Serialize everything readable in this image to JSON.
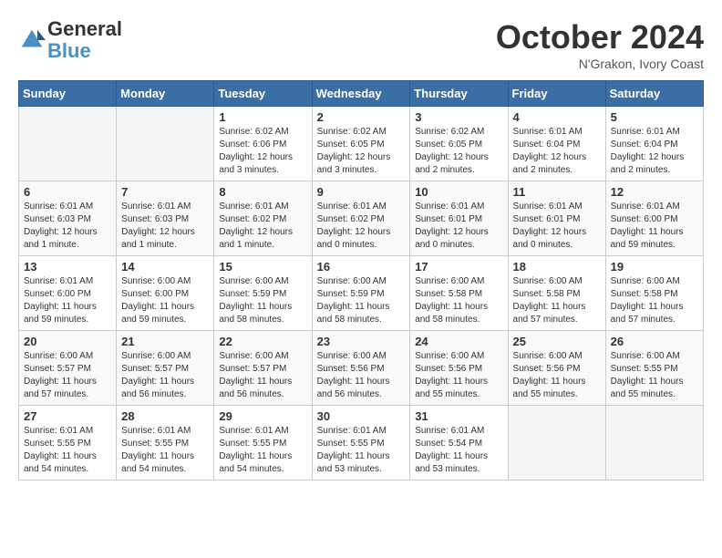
{
  "logo": {
    "text_general": "General",
    "text_blue": "Blue"
  },
  "header": {
    "month_title": "October 2024",
    "location": "N'Grakon, Ivory Coast"
  },
  "weekdays": [
    "Sunday",
    "Monday",
    "Tuesday",
    "Wednesday",
    "Thursday",
    "Friday",
    "Saturday"
  ],
  "weeks": [
    [
      {
        "day": "",
        "info": ""
      },
      {
        "day": "",
        "info": ""
      },
      {
        "day": "1",
        "info": "Sunrise: 6:02 AM\nSunset: 6:06 PM\nDaylight: 12 hours and 3 minutes."
      },
      {
        "day": "2",
        "info": "Sunrise: 6:02 AM\nSunset: 6:05 PM\nDaylight: 12 hours and 3 minutes."
      },
      {
        "day": "3",
        "info": "Sunrise: 6:02 AM\nSunset: 6:05 PM\nDaylight: 12 hours and 2 minutes."
      },
      {
        "day": "4",
        "info": "Sunrise: 6:01 AM\nSunset: 6:04 PM\nDaylight: 12 hours and 2 minutes."
      },
      {
        "day": "5",
        "info": "Sunrise: 6:01 AM\nSunset: 6:04 PM\nDaylight: 12 hours and 2 minutes."
      }
    ],
    [
      {
        "day": "6",
        "info": "Sunrise: 6:01 AM\nSunset: 6:03 PM\nDaylight: 12 hours and 1 minute."
      },
      {
        "day": "7",
        "info": "Sunrise: 6:01 AM\nSunset: 6:03 PM\nDaylight: 12 hours and 1 minute."
      },
      {
        "day": "8",
        "info": "Sunrise: 6:01 AM\nSunset: 6:02 PM\nDaylight: 12 hours and 1 minute."
      },
      {
        "day": "9",
        "info": "Sunrise: 6:01 AM\nSunset: 6:02 PM\nDaylight: 12 hours and 0 minutes."
      },
      {
        "day": "10",
        "info": "Sunrise: 6:01 AM\nSunset: 6:01 PM\nDaylight: 12 hours and 0 minutes."
      },
      {
        "day": "11",
        "info": "Sunrise: 6:01 AM\nSunset: 6:01 PM\nDaylight: 12 hours and 0 minutes."
      },
      {
        "day": "12",
        "info": "Sunrise: 6:01 AM\nSunset: 6:00 PM\nDaylight: 11 hours and 59 minutes."
      }
    ],
    [
      {
        "day": "13",
        "info": "Sunrise: 6:01 AM\nSunset: 6:00 PM\nDaylight: 11 hours and 59 minutes."
      },
      {
        "day": "14",
        "info": "Sunrise: 6:00 AM\nSunset: 6:00 PM\nDaylight: 11 hours and 59 minutes."
      },
      {
        "day": "15",
        "info": "Sunrise: 6:00 AM\nSunset: 5:59 PM\nDaylight: 11 hours and 58 minutes."
      },
      {
        "day": "16",
        "info": "Sunrise: 6:00 AM\nSunset: 5:59 PM\nDaylight: 11 hours and 58 minutes."
      },
      {
        "day": "17",
        "info": "Sunrise: 6:00 AM\nSunset: 5:58 PM\nDaylight: 11 hours and 58 minutes."
      },
      {
        "day": "18",
        "info": "Sunrise: 6:00 AM\nSunset: 5:58 PM\nDaylight: 11 hours and 57 minutes."
      },
      {
        "day": "19",
        "info": "Sunrise: 6:00 AM\nSunset: 5:58 PM\nDaylight: 11 hours and 57 minutes."
      }
    ],
    [
      {
        "day": "20",
        "info": "Sunrise: 6:00 AM\nSunset: 5:57 PM\nDaylight: 11 hours and 57 minutes."
      },
      {
        "day": "21",
        "info": "Sunrise: 6:00 AM\nSunset: 5:57 PM\nDaylight: 11 hours and 56 minutes."
      },
      {
        "day": "22",
        "info": "Sunrise: 6:00 AM\nSunset: 5:57 PM\nDaylight: 11 hours and 56 minutes."
      },
      {
        "day": "23",
        "info": "Sunrise: 6:00 AM\nSunset: 5:56 PM\nDaylight: 11 hours and 56 minutes."
      },
      {
        "day": "24",
        "info": "Sunrise: 6:00 AM\nSunset: 5:56 PM\nDaylight: 11 hours and 55 minutes."
      },
      {
        "day": "25",
        "info": "Sunrise: 6:00 AM\nSunset: 5:56 PM\nDaylight: 11 hours and 55 minutes."
      },
      {
        "day": "26",
        "info": "Sunrise: 6:00 AM\nSunset: 5:55 PM\nDaylight: 11 hours and 55 minutes."
      }
    ],
    [
      {
        "day": "27",
        "info": "Sunrise: 6:01 AM\nSunset: 5:55 PM\nDaylight: 11 hours and 54 minutes."
      },
      {
        "day": "28",
        "info": "Sunrise: 6:01 AM\nSunset: 5:55 PM\nDaylight: 11 hours and 54 minutes."
      },
      {
        "day": "29",
        "info": "Sunrise: 6:01 AM\nSunset: 5:55 PM\nDaylight: 11 hours and 54 minutes."
      },
      {
        "day": "30",
        "info": "Sunrise: 6:01 AM\nSunset: 5:55 PM\nDaylight: 11 hours and 53 minutes."
      },
      {
        "day": "31",
        "info": "Sunrise: 6:01 AM\nSunset: 5:54 PM\nDaylight: 11 hours and 53 minutes."
      },
      {
        "day": "",
        "info": ""
      },
      {
        "day": "",
        "info": ""
      }
    ]
  ]
}
